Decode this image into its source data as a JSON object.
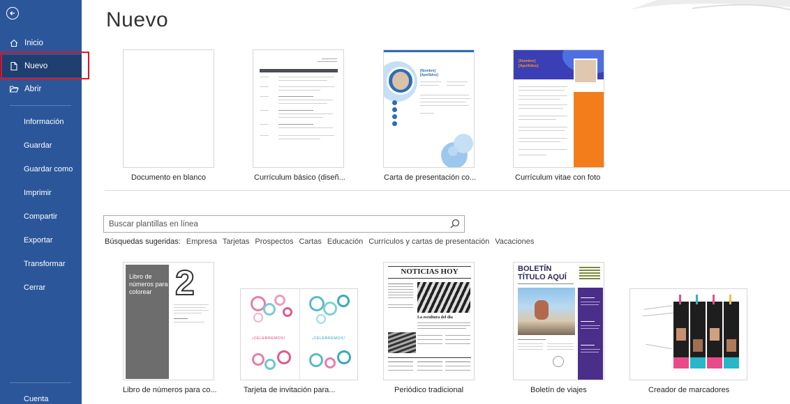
{
  "sidebar": {
    "back_label": "",
    "items": [
      {
        "label": "Inicio"
      },
      {
        "label": "Nuevo"
      },
      {
        "label": "Abrir"
      }
    ],
    "plain_items": [
      "Información",
      "Guardar",
      "Guardar como",
      "Imprimir",
      "Compartir",
      "Exportar",
      "Transformar",
      "Cerrar"
    ],
    "account": "Cuenta",
    "colors": {
      "background": "#2b579a",
      "selected": "#1e3f70",
      "highlight": "#e81123"
    }
  },
  "main": {
    "title": "Nuevo",
    "featured": [
      {
        "caption": "Documento en blanco"
      },
      {
        "caption": "Currículum básico (diseñ..."
      },
      {
        "caption": "Carta de presentación co..."
      },
      {
        "caption": "Currículum vitae con foto"
      }
    ],
    "search": {
      "placeholder": "Buscar plantillas en línea"
    },
    "suggested": {
      "label": "Búsquedas sugeridas:",
      "tags": [
        "Empresa",
        "Tarjetas",
        "Prospectos",
        "Cartas",
        "Educación",
        "Currículos y cartas de presentación",
        "Vacaciones"
      ]
    },
    "templates": [
      {
        "caption": "Libro de números para co..."
      },
      {
        "caption": "Tarjeta de invitación para..."
      },
      {
        "caption": "Periódico tradicional"
      },
      {
        "caption": "Boletín de viajes"
      },
      {
        "caption": "Creador de marcadores"
      }
    ],
    "thumb_text": {
      "resume_photo_name": "[Nombre] [Apellidos]",
      "numbers_book": "Libro de números para colorear",
      "numbers_digit": "2",
      "celebremos": "¡CELEBREMOS!",
      "newspaper": "NOTICIAS HOY",
      "newspaper_headline": "La escultura del día",
      "newsletter_title_1": "BOLETÍN",
      "newsletter_title_2": "TÍTULO AQUÍ"
    }
  }
}
